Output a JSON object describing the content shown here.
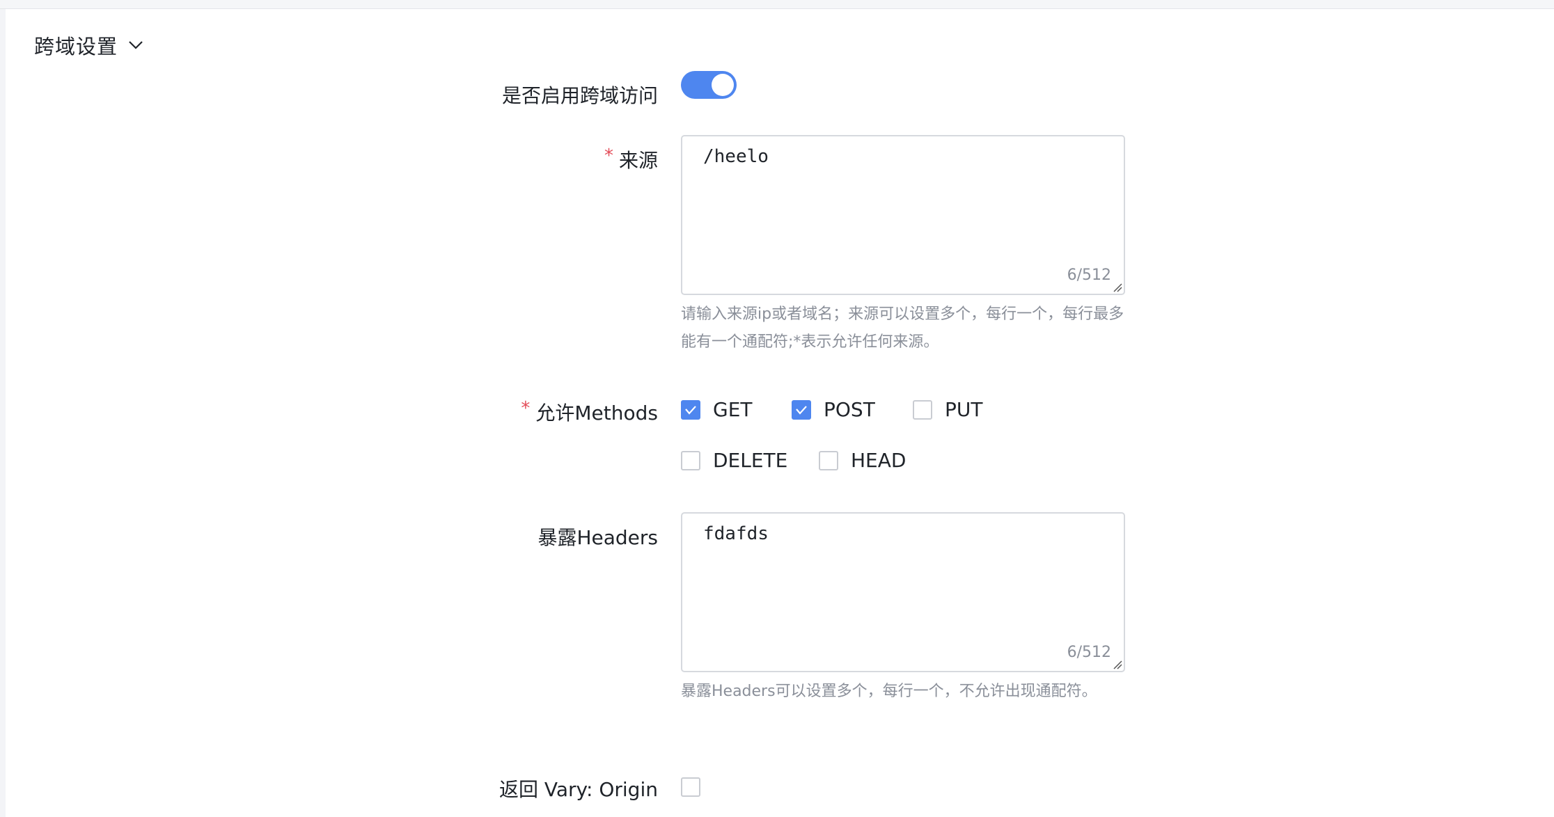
{
  "section": {
    "title": "跨域设置",
    "chevron_icon": "chevron-down-icon"
  },
  "fields": {
    "enable_cors": {
      "label": "是否启用跨域访问",
      "enabled": true
    },
    "origin": {
      "label": "来源",
      "required_mark": "*",
      "value": "/heelo",
      "counter": "6/512",
      "help": "请输入来源ip或者域名；来源可以设置多个，每行一个，每行最多能有一个通配符;*表示允许任何来源。"
    },
    "methods": {
      "label": "允许Methods",
      "required_mark": "*",
      "options": [
        {
          "label": "GET",
          "checked": true
        },
        {
          "label": "POST",
          "checked": true
        },
        {
          "label": "PUT",
          "checked": false
        },
        {
          "label": "DELETE",
          "checked": false
        },
        {
          "label": "HEAD",
          "checked": false
        }
      ]
    },
    "expose_headers": {
      "label": "暴露Headers",
      "value": "fdafds",
      "counter": "6/512",
      "help": "暴露Headers可以设置多个，每行一个，不允许出现通配符。"
    },
    "vary_origin": {
      "label": "返回 Vary: Origin",
      "checked": false
    }
  },
  "colors": {
    "accent": "#4e86ef",
    "required": "#e34d59",
    "help_text": "#8a8f99",
    "border": "#d6d9de"
  }
}
